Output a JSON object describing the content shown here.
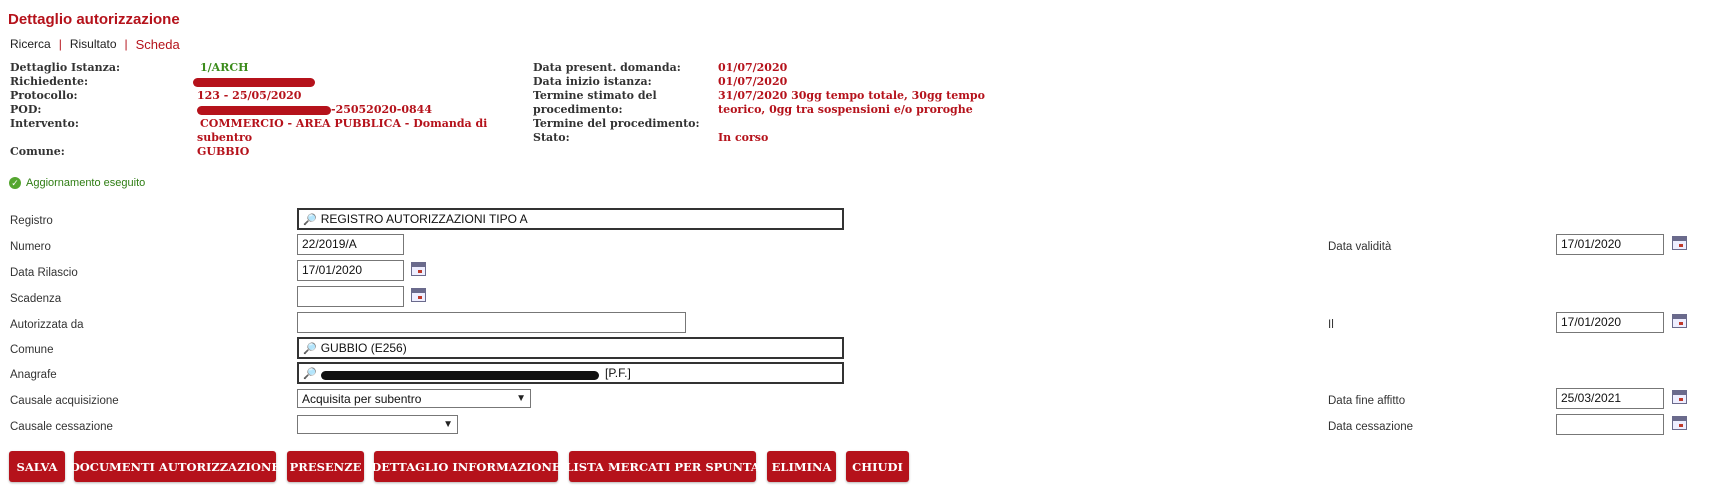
{
  "page": {
    "title": "Dettaglio autorizzazione"
  },
  "breadcrumb": {
    "items": [
      "Ricerca",
      "Risultato",
      "Scheda"
    ],
    "separator": "|"
  },
  "info_left": {
    "dettaglio_label": "Dettaglio Istanza:",
    "dettaglio_value": "1/ARCH",
    "richiedente_label": "Richiedente:",
    "protocollo_label": "Protocollo:",
    "protocollo_value": "123 - 25/05/2020",
    "pod_label": "POD:",
    "pod_value": "-25052020-0844",
    "intervento_label": "Intervento:",
    "intervento_value_1": "COMMERCIO - AREA PUBBLICA - Domanda di",
    "intervento_value_2": "subentro",
    "comune_label": "Comune:",
    "comune_value": "GUBBIO"
  },
  "info_right": {
    "present_label": "Data present. domanda:",
    "present_value": "01/07/2020",
    "inizio_label": "Data inizio istanza:",
    "inizio_value": "01/07/2020",
    "stimato_label_1": "Termine stimato del",
    "stimato_label_2": "procedimento:",
    "stimato_value_1": "31/07/2020  30gg tempo totale, 30gg tempo",
    "stimato_value_2": "teorico, 0gg tra sospensioni e/o proroghe",
    "termine_label": "Termine del procedimento:",
    "stato_label": "Stato:",
    "stato_value": "In corso"
  },
  "status": {
    "message": "Aggiornamento eseguito",
    "icon": "check-circle-icon"
  },
  "form": {
    "registro_label": "Registro",
    "registro_value": "REGISTRO AUTORIZZAZIONI TIPO A",
    "numero_label": "Numero",
    "numero_value": "22/2019/A",
    "rilascio_label": "Data Rilascio",
    "rilascio_value": "17/01/2020",
    "scadenza_label": "Scadenza",
    "scadenza_value": "",
    "autorizzata_label": "Autorizzata da",
    "autorizzata_value": "",
    "comune_label": "Comune",
    "comune_value": "GUBBIO (E256)",
    "anagrafe_label": "Anagrafe",
    "anagrafe_suffix": "[P.F.]",
    "causale_acq_label": "Causale acquisizione",
    "causale_acq_value": "Acquisita per subentro",
    "causale_cess_label": "Causale cessazione",
    "causale_cess_value": "",
    "validita_label": "Data validità",
    "validita_value": "17/01/2020",
    "il_label": "Il",
    "il_value": "17/01/2020",
    "fine_affitto_label": "Data fine affitto",
    "fine_affitto_value": "25/03/2021",
    "cessazione_label": "Data cessazione",
    "cessazione_value": ""
  },
  "buttons": {
    "salva": "SALVA",
    "documenti": "DOCUMENTI AUTORIZZAZIONE",
    "presenze": "PRESENZE",
    "dettaglio": "DETTAGLIO INFORMAZIONE",
    "lista": "LISTA MERCATI PER SPUNTA",
    "elimina": "ELIMINA",
    "chiudi": "CHIUDI"
  },
  "colors": {
    "brand": "#b5121b",
    "success": "#3c8c1c"
  }
}
